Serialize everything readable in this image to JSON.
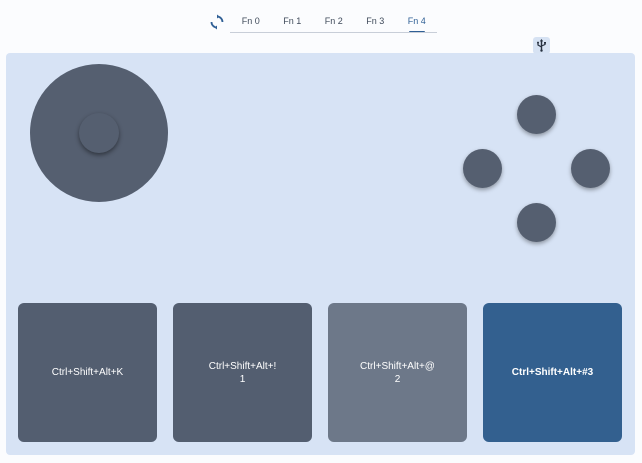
{
  "tabs": [
    {
      "label": "Fn 0",
      "active": false
    },
    {
      "label": "Fn 1",
      "active": false
    },
    {
      "label": "Fn 2",
      "active": false
    },
    {
      "label": "Fn 3",
      "active": false
    },
    {
      "label": "Fn 4",
      "active": true
    }
  ],
  "icons": {
    "sync": "sync-icon",
    "usb": "usb-icon"
  },
  "keys": [
    {
      "line1": "Ctrl+Shift+Alt+K",
      "line2": "",
      "color": "#535e70",
      "bold": false
    },
    {
      "line1": "Ctrl+Shift+Alt+!",
      "line2": "1",
      "color": "#535e70",
      "bold": false
    },
    {
      "line1": "Ctrl+Shift+Alt+@",
      "line2": "2",
      "color": "#6d7889",
      "bold": false
    },
    {
      "line1": "Ctrl+Shift+Alt+#3",
      "line2": "",
      "color": "#33608f",
      "bold": true
    }
  ],
  "colors": {
    "accent": "#2f5f95",
    "pad_background": "#d7e3f5",
    "control": "#555f70"
  }
}
